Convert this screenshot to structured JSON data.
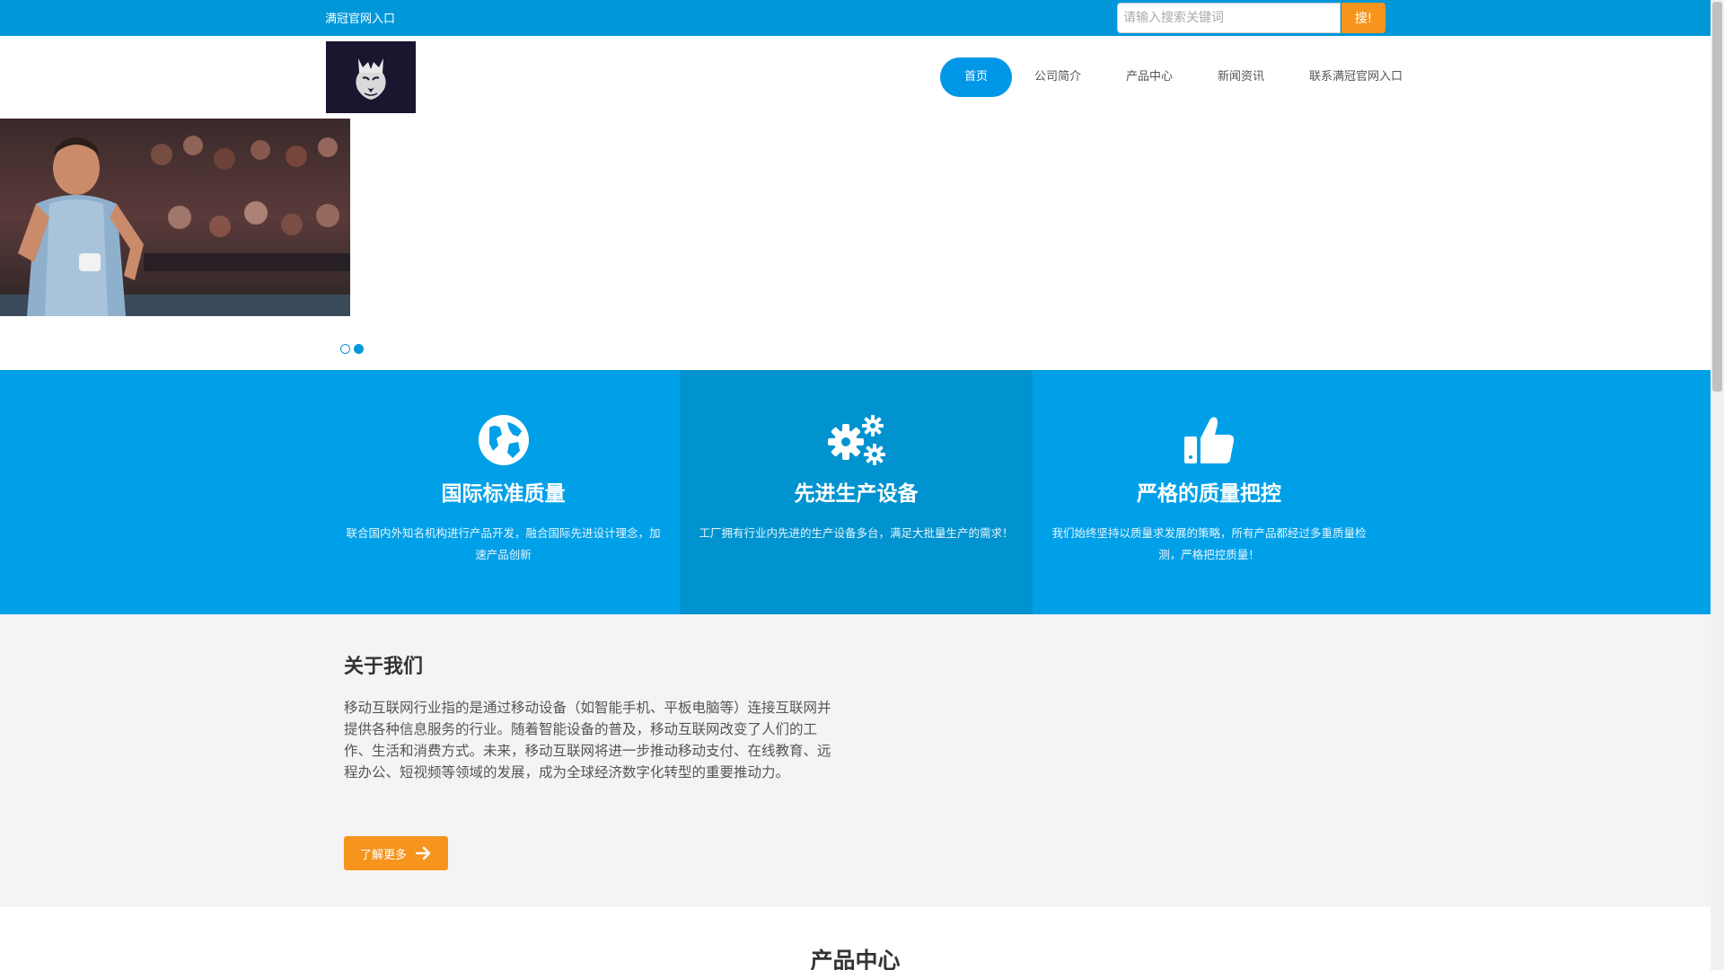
{
  "topbar": {
    "site_link": "满冠官网入口",
    "search_placeholder": "请输入搜索关键词",
    "search_button": "搜!"
  },
  "nav": {
    "items": [
      {
        "label": "首页",
        "active": true
      },
      {
        "label": "公司简介"
      },
      {
        "label": "产品中心"
      },
      {
        "label": "新闻资讯"
      },
      {
        "label": "联系满冠官网入口"
      }
    ]
  },
  "banner": {
    "slide_count": 2,
    "active_slide": 2
  },
  "features": [
    {
      "icon": "globe-icon",
      "title": "国际标准质量",
      "desc": "联合国内外知名机构进行产品开发，融合国际先进设计理念，加速产品创新"
    },
    {
      "icon": "gears-icon",
      "title": "先进生产设备",
      "desc": "工厂拥有行业内先进的生产设备多台，满足大批量生产的需求！"
    },
    {
      "icon": "thumbs-up-icon",
      "title": "严格的质量把控",
      "desc": "我们始终坚持以质量求发展的策略，所有产品都经过多重质量检测，严格把控质量！"
    }
  ],
  "about": {
    "title": "关于我们",
    "text": "移动互联网行业指的是通过移动设备（如智能手机、平板电脑等）连接互联网并提供各种信息服务的行业。随着智能设备的普及，移动互联网改变了人们的工作、生活和消费方式。未来，移动互联网将进一步推动移动支付、在线教育、远程办公、短视频等领域的发展，成为全球经济数字化转型的重要推动力。",
    "more_button": "了解更多"
  },
  "products": {
    "title": "产品中心"
  },
  "colors": {
    "primary": "#0097d9",
    "feature_bg": "#00a0e9",
    "feature_mid_bg": "#0093d0",
    "accent_orange": "#f7941d",
    "about_bg": "#f4f4f4"
  }
}
